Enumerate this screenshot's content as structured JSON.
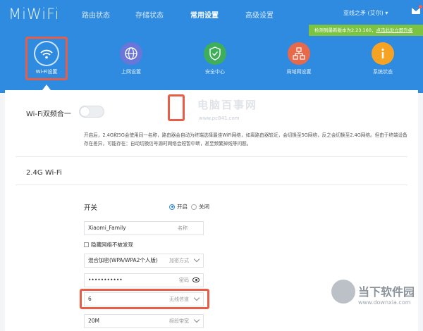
{
  "header": {
    "logo": "MiWiFi",
    "nav": [
      "路由状态",
      "存储状态",
      "常用设置",
      "高级设置"
    ],
    "active_nav": "常用设置",
    "user": "亚线之矛 (艾尔) ▾",
    "update_text": "检测到最新版本为2.23.160，",
    "update_link": "点击此处立即升级"
  },
  "tiles": [
    {
      "label": "Wi-Fi设置",
      "color": "#2e8be0",
      "icon": "wifi-icon"
    },
    {
      "label": "上网设置",
      "color": "#5d6fd6",
      "icon": "globe-icon"
    },
    {
      "label": "安全中心",
      "color": "#3fae5b",
      "icon": "shield-icon"
    },
    {
      "label": "局域网设置",
      "color": "#e8684a",
      "icon": "network-icon"
    },
    {
      "label": "系统状态",
      "color": "#f6a323",
      "icon": "info-icon"
    }
  ],
  "dual_band": {
    "title": "Wi-Fi双频合一",
    "desc": "开启后，2.4G和5G会使用同一名称，路由器会自动为终端选择最佳WiFi网络，如离路由器较近，会切换至5G网络，反之会切换至2.4G网络。但由于终端设备存在差异，可能存在：自动切换信号源时网络会短暂中断，甚至频繁掉线等问题。"
  },
  "wifi24": {
    "section": "2.4G Wi-Fi",
    "switch_label": "开关",
    "on_label": "开启",
    "off_label": "关闭",
    "ssid": "Xiaomi_Family",
    "ssid_hint": "名称",
    "hide_label": "隐藏网络不被发现",
    "encryption": "混合加密(WPA/WPA2个人版)",
    "encryption_hint": "加密方式",
    "password": "•••••••••••",
    "password_hint": "密码",
    "channel": "6",
    "channel_hint": "无线信道",
    "bandwidth": "20M",
    "bandwidth_hint": "频段带宽"
  },
  "watermarks": {
    "cn": "电脑百事网",
    "url": "www.pc841.com",
    "site2_name": "当下软件园",
    "site2_url": "www.downxia.com"
  }
}
